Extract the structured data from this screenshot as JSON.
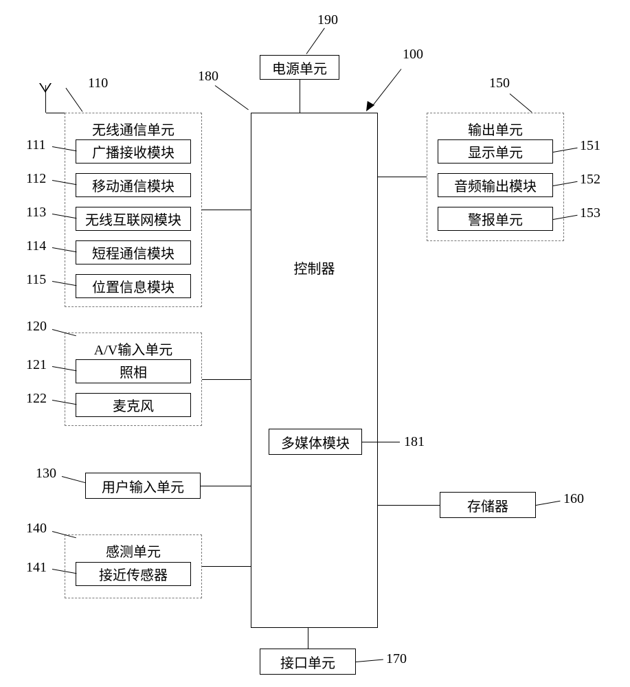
{
  "refs": {
    "n190": "190",
    "n100": "100",
    "n180": "180",
    "n150": "150",
    "n110": "110",
    "n111": "111",
    "n112": "112",
    "n113": "113",
    "n114": "114",
    "n115": "115",
    "n120": "120",
    "n121": "121",
    "n122": "122",
    "n130": "130",
    "n140": "140",
    "n141": "141",
    "n151": "151",
    "n152": "152",
    "n153": "153",
    "n160": "160",
    "n170": "170",
    "n181": "181"
  },
  "blocks": {
    "power": "电源单元",
    "controller": "控制器",
    "multimedia": "多媒体模块",
    "wireless_unit": "无线通信单元",
    "broadcast": "广播接收模块",
    "mobile_comm": "移动通信模块",
    "wireless_net": "无线互联网模块",
    "short_range": "短程通信模块",
    "location": "位置信息模块",
    "av_unit": "A/V输入单元",
    "camera": "照相",
    "microphone": "麦克风",
    "user_input": "用户输入单元",
    "sensing_unit": "感测单元",
    "proximity": "接近传感器",
    "output_unit": "输出单元",
    "display": "显示单元",
    "audio_out": "音频输出模块",
    "alarm": "警报单元",
    "memory": "存储器",
    "interface": "接口单元"
  }
}
